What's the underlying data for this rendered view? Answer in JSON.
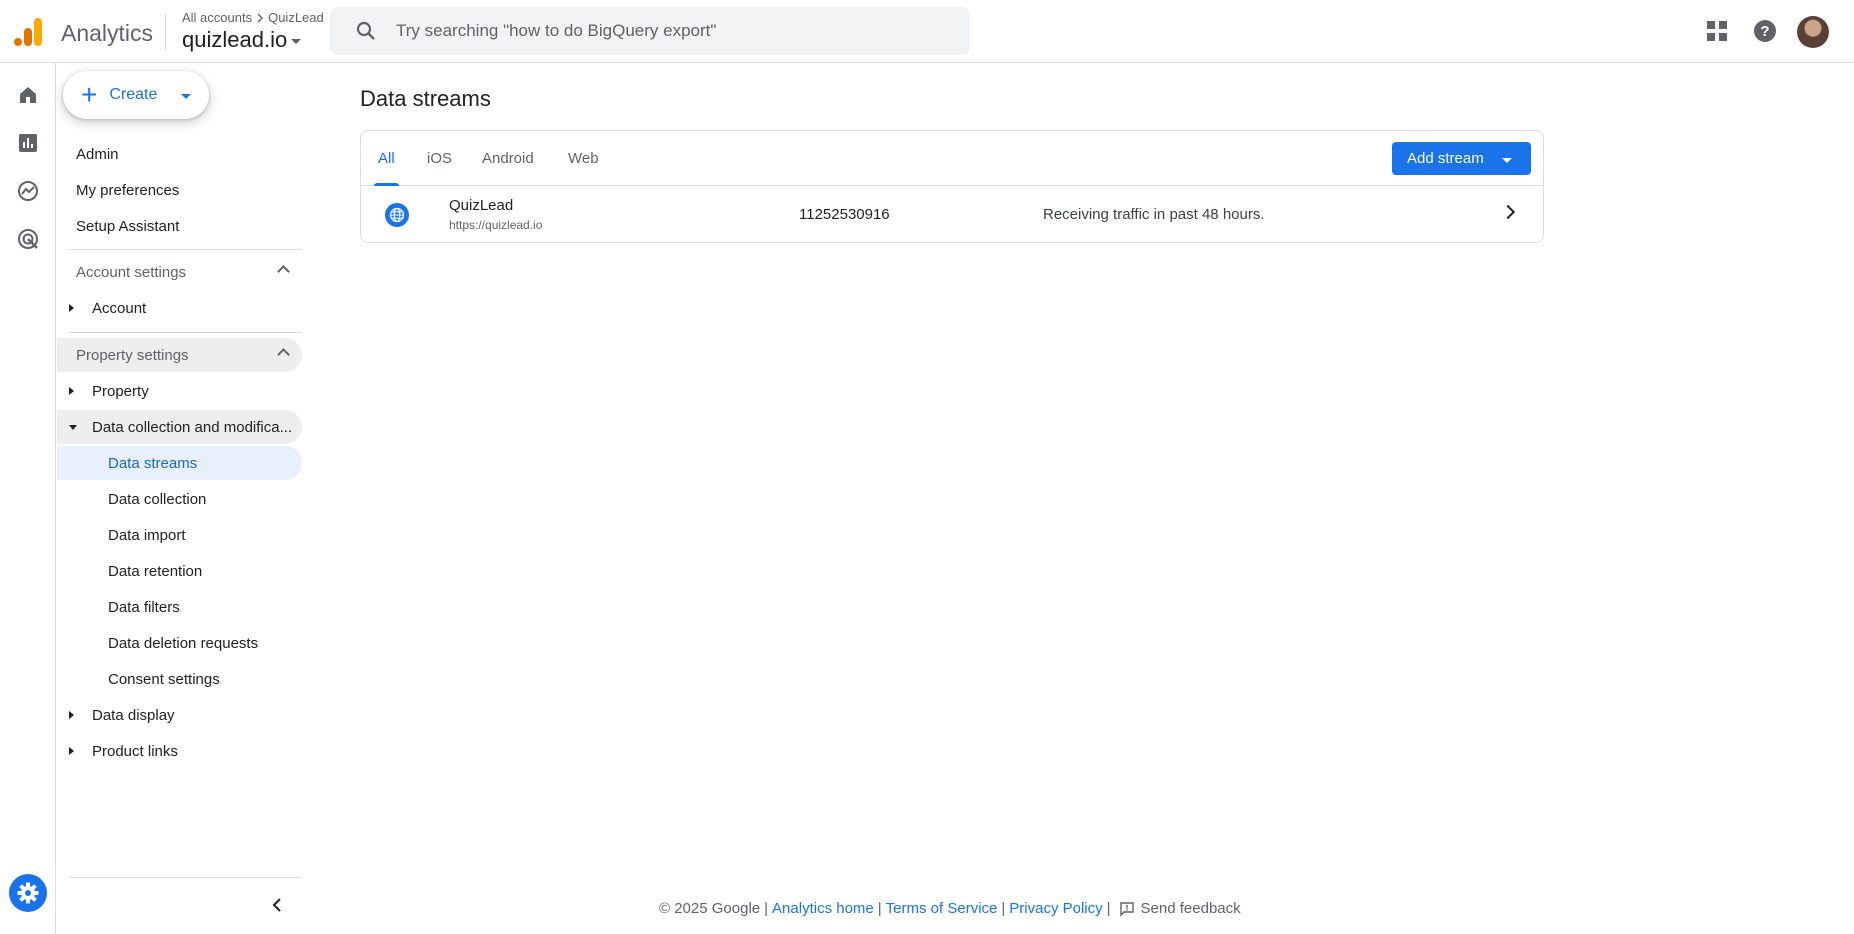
{
  "header": {
    "app_name": "Analytics",
    "breadcrumb": {
      "parent": "All accounts",
      "current": "QuizLead"
    },
    "property": "quizlead.io",
    "search_placeholder": "Try searching \"how to do BigQuery export\""
  },
  "nav": {
    "create_label": "Create",
    "admin": "Admin",
    "my_preferences": "My preferences",
    "setup_assistant": "Setup Assistant",
    "account_settings": "Account settings",
    "account": "Account",
    "property_settings": "Property settings",
    "property": "Property",
    "data_collection_mod": "Data collection and modifica...",
    "sub_items": [
      "Data streams",
      "Data collection",
      "Data import",
      "Data retention",
      "Data filters",
      "Data deletion requests",
      "Consent settings"
    ],
    "data_display": "Data display",
    "product_links": "Product links"
  },
  "main": {
    "title": "Data streams",
    "tabs": [
      "All",
      "iOS",
      "Android",
      "Web"
    ],
    "active_tab": "All",
    "add_stream_label": "Add stream",
    "streams": [
      {
        "name": "QuizLead",
        "url": "https://quizlead.io",
        "id": "11252530916",
        "status": "Receiving traffic in past 48 hours."
      }
    ]
  },
  "footer": {
    "copyright": "© 2025 Google",
    "analytics_home": "Analytics home",
    "terms": "Terms of Service",
    "privacy": "Privacy Policy",
    "feedback": "Send feedback"
  },
  "colors": {
    "accent": "#1a73e8",
    "logo_orange": "#e37400",
    "logo_yellow": "#f9ab00",
    "selected_bg": "#e8f0fe"
  }
}
